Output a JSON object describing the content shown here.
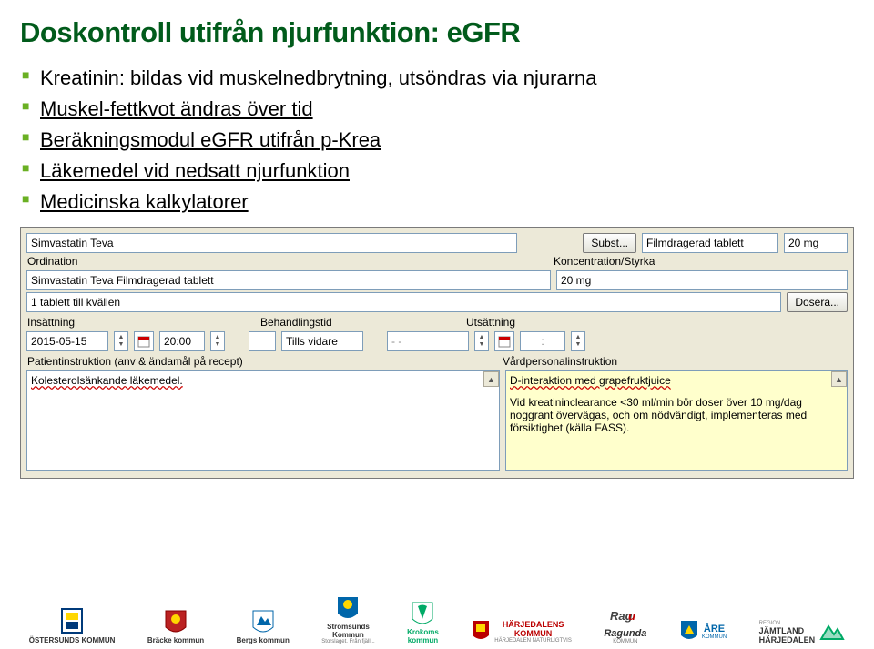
{
  "title": "Doskontroll utifrån njurfunktion: eGFR",
  "bullets": {
    "b1": "Kreatinin: bildas vid muskelnedbrytning, utsöndras via njurarna",
    "b2": "Muskel-fettkvot ändras över tid",
    "b3": "Beräkningsmodul eGFR utifrån p-Krea",
    "b4": "Läkemedel vid nedsatt njurfunktion",
    "b5": "Medicinska kalkylatorer"
  },
  "form": {
    "med_name": "Simvastatin Teva",
    "subst_btn": "Subst...",
    "form_type": "Filmdragerad tablett",
    "strength1": "20 mg",
    "label_ord": "Ordination",
    "label_konc": "Koncentration/Styrka",
    "ord_value": "Simvastatin Teva Filmdragerad tablett",
    "konc_value": "20 mg",
    "dose_text": "1 tablett till kvällen",
    "dosera_btn": "Dosera...",
    "label_ins": "Insättning",
    "label_beh": "Behandlingstid",
    "label_uts": "Utsättning",
    "ins_date": "2015-05-15",
    "ins_time": "20:00",
    "beh_val": "Tills vidare",
    "uts_date": "- -",
    "uts_time": ":",
    "label_pat": "Patientinstruktion (anv & ändamål på recept)",
    "label_vard": "Vårdpersonalinstruktion",
    "pat_text": "Kolesterolsänkande läkemedel.",
    "vard_line1": "D-interaktion med grapefruktjuice",
    "vard_line2": "Vid kreatininclearance <30 ml/min bör doser över 10 mg/dag noggrant övervägas, och om nödvändigt, implementeras med försiktighet (källa FASS)."
  },
  "logos": {
    "l1": "ÖSTERSUNDS KOMMUN",
    "l2": "Bräcke kommun",
    "l3": "Bergs kommun",
    "l4a": "Strömsunds",
    "l4b": "Kommun",
    "l5a": "Krokoms",
    "l5b": "kommun",
    "l6a": "HÄRJEDALENS",
    "l6b": "KOMMUN",
    "l7": "Ragunda",
    "l8a": "ÅRE",
    "l8b": "KOMMUN",
    "l9a": "REGION",
    "l9b": "JÄMTLAND",
    "l9c": "HÄRJEDALEN"
  }
}
